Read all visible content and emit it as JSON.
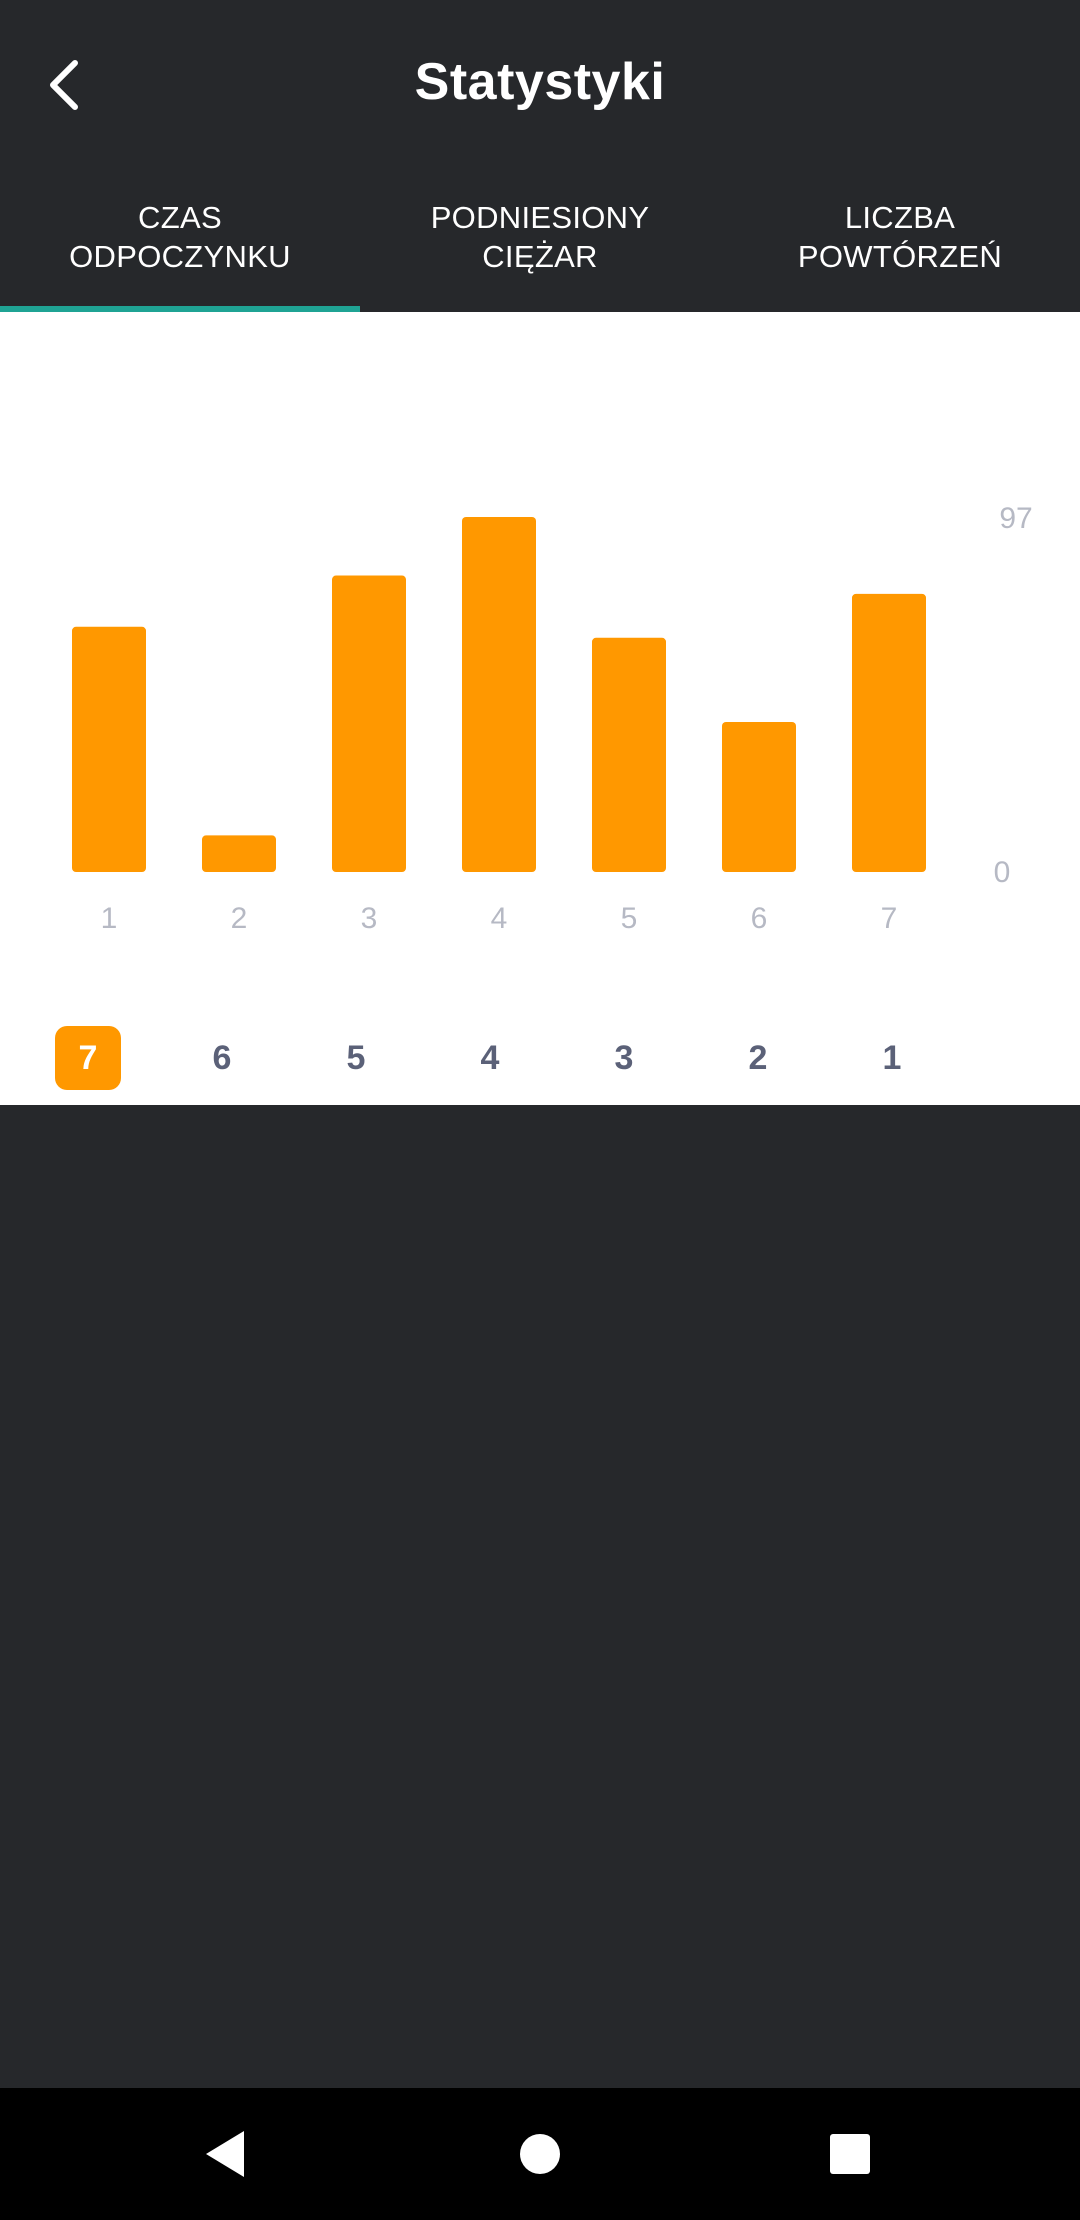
{
  "header": {
    "title": "Statystyki",
    "back_icon": "chevron-left-icon"
  },
  "tabs": [
    {
      "label": "CZAS\nODPOCZYNKU",
      "active": true
    },
    {
      "label": "PODNIESIONY\nCIĘŻAR",
      "active": false
    },
    {
      "label": "LICZBA\nPOWTÓRZEŃ",
      "active": false
    }
  ],
  "colors": {
    "background": "#26282b",
    "tab_indicator": "#1fa394",
    "bar": "#ff9800",
    "axis_text": "#b6b9c4",
    "selector_text": "#5b6178"
  },
  "chart_data": {
    "type": "bar",
    "categories": [
      "1",
      "2",
      "3",
      "4",
      "5",
      "6",
      "7"
    ],
    "values": [
      67,
      10,
      81,
      97,
      64,
      41,
      76
    ],
    "ylim": [
      0,
      97
    ],
    "y_tick_labels": [
      "97",
      "0"
    ],
    "title": "",
    "xlabel": "",
    "ylabel": "",
    "grid": false,
    "legend": "none"
  },
  "selector": {
    "items": [
      "7",
      "6",
      "5",
      "4",
      "3",
      "2",
      "1"
    ],
    "selected": "7"
  },
  "navbar": {
    "back_icon": "triangle-back-icon",
    "home_icon": "circle-home-icon",
    "recents_icon": "square-recents-icon"
  }
}
